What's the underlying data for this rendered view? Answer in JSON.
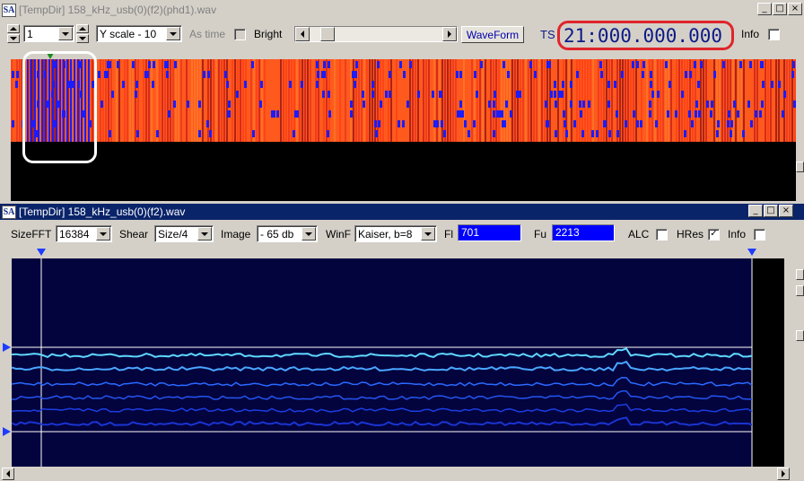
{
  "top_window": {
    "title": "[TempDir] 158_kHz_usb(0)(f2)(phd1).wav",
    "app_icon_text": "SA",
    "controls": {
      "spin_value": "1",
      "yscale": "Y scale - 10",
      "as_time_label": "As time",
      "bright_label": "Bright",
      "waveform_label": "WaveForm",
      "ts_label": "TS",
      "ts_value": "21:000.000.000",
      "info_label": "Info"
    }
  },
  "bottom_window": {
    "title": "[TempDir] 158_kHz_usb(0)(f2).wav",
    "app_icon_text": "SA",
    "controls": {
      "sizefft_label": "SizeFFT",
      "sizefft_value": "16384",
      "shear_label": "Shear",
      "shear_value": "Size/4",
      "image_label": "Image",
      "image_value": "- 65 db",
      "winf_label": "WinF",
      "winf_value": "Kaiser, b=8",
      "fl_label": "Fl",
      "fl_value": "701",
      "fu_label": "Fu",
      "fu_value": "2213",
      "alc_label": "ALC",
      "hres_label": "HRes",
      "hres_checked": "✓",
      "info_label": "Info"
    }
  },
  "window_buttons": {
    "minimize": "_",
    "maximize": "□",
    "close": "×"
  },
  "colors": {
    "highlight_red": "#e0252b",
    "waterfall_orange": "#ff5a1e",
    "waterfall_blue": "#1c1cff",
    "spectrogram_bg": "#03033e",
    "trace_cyan": "#5fd8ff"
  }
}
